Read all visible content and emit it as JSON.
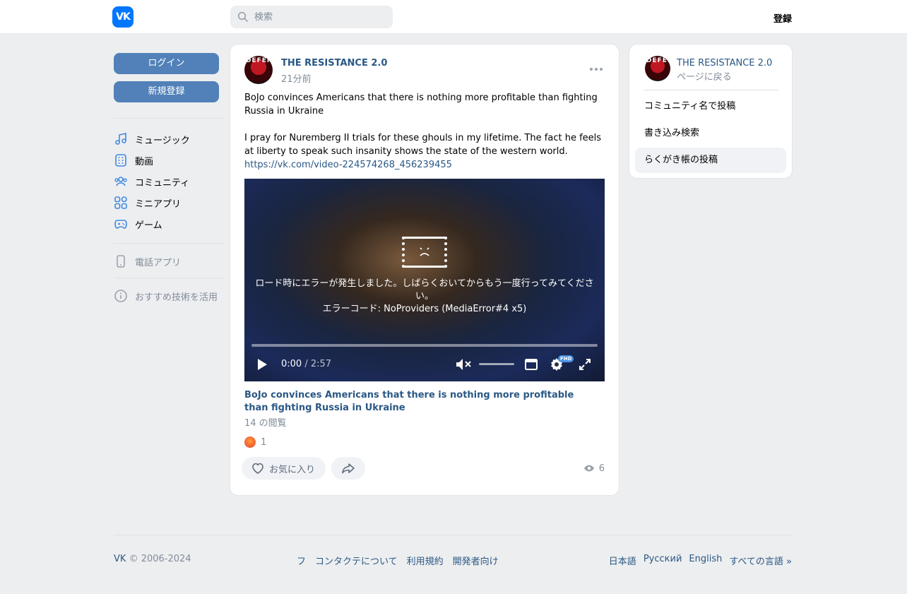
{
  "header": {
    "logo_text": "VK",
    "search_placeholder": "検索",
    "register_label": "登録"
  },
  "sidebar": {
    "login_label": "ログイン",
    "signup_label": "新規登録",
    "items": [
      {
        "label": "ミュージック",
        "icon": "music-note-icon"
      },
      {
        "label": "動画",
        "icon": "video-icon"
      },
      {
        "label": "コミュニティ",
        "icon": "community-icon"
      },
      {
        "label": "ミニアプリ",
        "icon": "apps-icon"
      },
      {
        "label": "ゲーム",
        "icon": "gamepad-icon"
      }
    ],
    "phone_app_label": "電話アプリ",
    "recommend_label": "おすすめ技術を活用"
  },
  "post": {
    "author": "THE RESISTANCE 2.0",
    "avatar_text": "DEFEN",
    "time": "21分前",
    "text_line1": "BoJo convinces Americans that there is nothing more profitable than fighting Russia in Ukraine",
    "text_line2": "I pray for Nuremberg II trials for these ghouls in my lifetime. The fact he feels at liberty to speak such insanity shows the state of the western world.",
    "link": "https://vk.com/video-224574268_456239455",
    "video": {
      "error_line1": "ロード時にエラーが発生しました。しばらくおいてからもう一度行ってみてください。",
      "error_line2": "エラーコード: NoProviders (MediaError#4 x5)",
      "current_time": "0:00",
      "duration": "/ 2:57",
      "quality_badge": "FHD"
    },
    "video_title": "BoJo convinces Americans that there is nothing more profitable than fighting Russia in Ukraine",
    "video_views": "14 の閲覧",
    "reaction_count": "1",
    "like_label": "お気に入り",
    "views_count": "6"
  },
  "right_panel": {
    "title": "THE RESISTANCE 2.0",
    "back_label": "ページに戻る",
    "items": [
      "コミュニティ名で投稿",
      "書き込み検索",
      "らくがき帳の投稿"
    ]
  },
  "footer": {
    "brand": "VK",
    "copyright": "© 2006-2024",
    "links": [
      "フ",
      "コンタクテについて",
      "利用規約",
      "開発者向け"
    ],
    "languages": [
      "日本語",
      "Русский",
      "English",
      "すべての言語 »"
    ]
  },
  "colors": {
    "accent": "#0077ff",
    "link": "#2a5885",
    "button": "#5181b8",
    "background": "#edeef0"
  }
}
